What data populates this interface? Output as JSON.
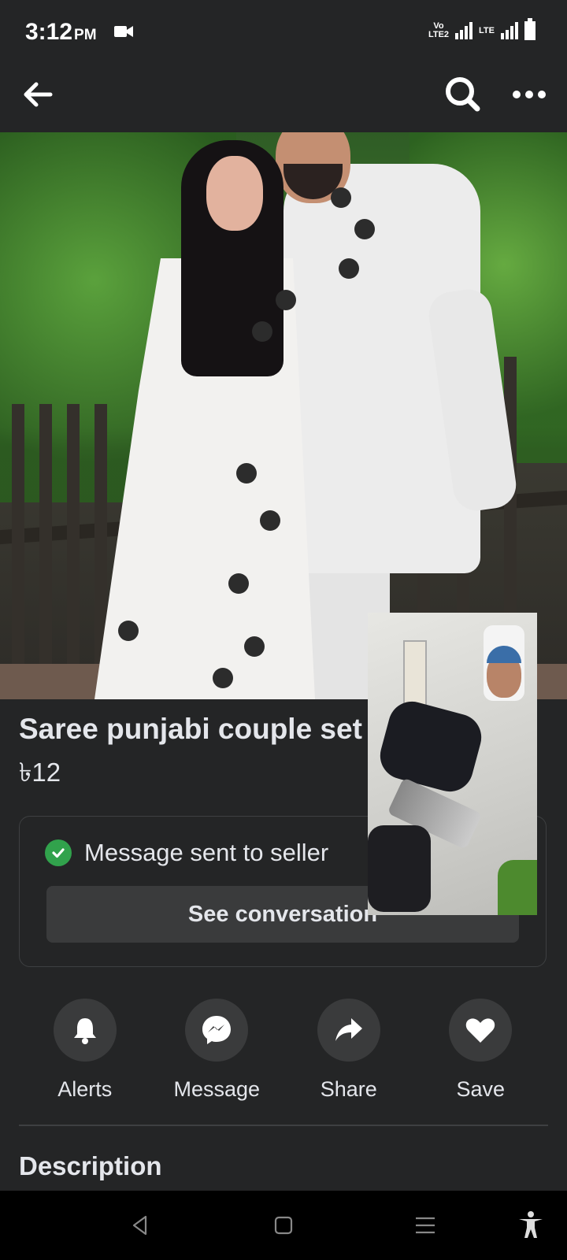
{
  "status_bar": {
    "time": "3:12",
    "ampm": "PM",
    "volte_top": "Vo",
    "volte_bottom": "LTE2",
    "network_type": "LTE"
  },
  "app_bar": {
    "back_icon": "arrow-left-icon",
    "search_icon": "search-icon",
    "more_icon": "more-horizontal-icon"
  },
  "product": {
    "title": "Saree punjabi couple set",
    "price": "৳12"
  },
  "seller_card": {
    "status_text": "Message sent to seller",
    "button_label": "See conversation"
  },
  "actions": [
    {
      "label": "Alerts",
      "icon": "bell-icon"
    },
    {
      "label": "Message",
      "icon": "messenger-icon"
    },
    {
      "label": "Share",
      "icon": "share-arrow-icon"
    },
    {
      "label": "Save",
      "icon": "heart-icon"
    }
  ],
  "sections": {
    "description_heading": "Description"
  },
  "colors": {
    "background": "#242526",
    "surface": "#3a3b3c",
    "text": "#e4e6eb",
    "success": "#31a24c"
  }
}
